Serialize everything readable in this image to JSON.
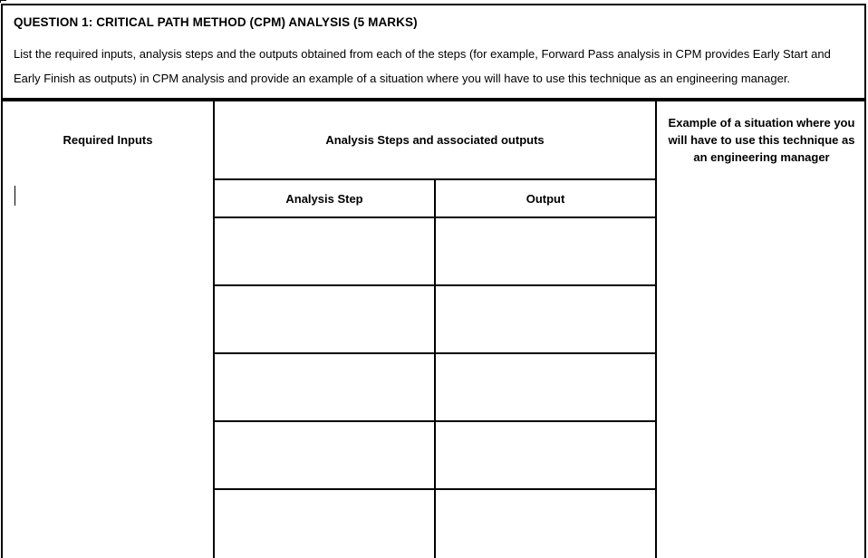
{
  "document": {
    "question": {
      "title": "QUESTION 1: CRITICAL PATH METHOD (CPM) ANALYSIS (5 MARKS)",
      "body": "List the required inputs, analysis steps and the outputs obtained from each of the steps (for example, Forward Pass analysis in CPM provides Early Start and Early Finish as outputs) in CPM analysis and provide an example of a situation where you will have to use this technique as an engineering manager."
    },
    "table": {
      "headers": {
        "required_inputs": "Required Inputs",
        "analysis_steps": "Analysis Steps and associated outputs",
        "example": "Example of a situation where you will have to use this technique as an engineering manager"
      },
      "subheaders": {
        "analysis_step": "Analysis Step",
        "output": "Output"
      },
      "rows": [
        {
          "analysis_step": "",
          "output": ""
        },
        {
          "analysis_step": "",
          "output": ""
        },
        {
          "analysis_step": "",
          "output": ""
        },
        {
          "analysis_step": "",
          "output": ""
        },
        {
          "analysis_step": "",
          "output": ""
        }
      ],
      "required_inputs_cell": "",
      "example_cell": ""
    }
  },
  "colors": {
    "border": "#000000",
    "background": "#ffffff",
    "text": "#000000"
  }
}
